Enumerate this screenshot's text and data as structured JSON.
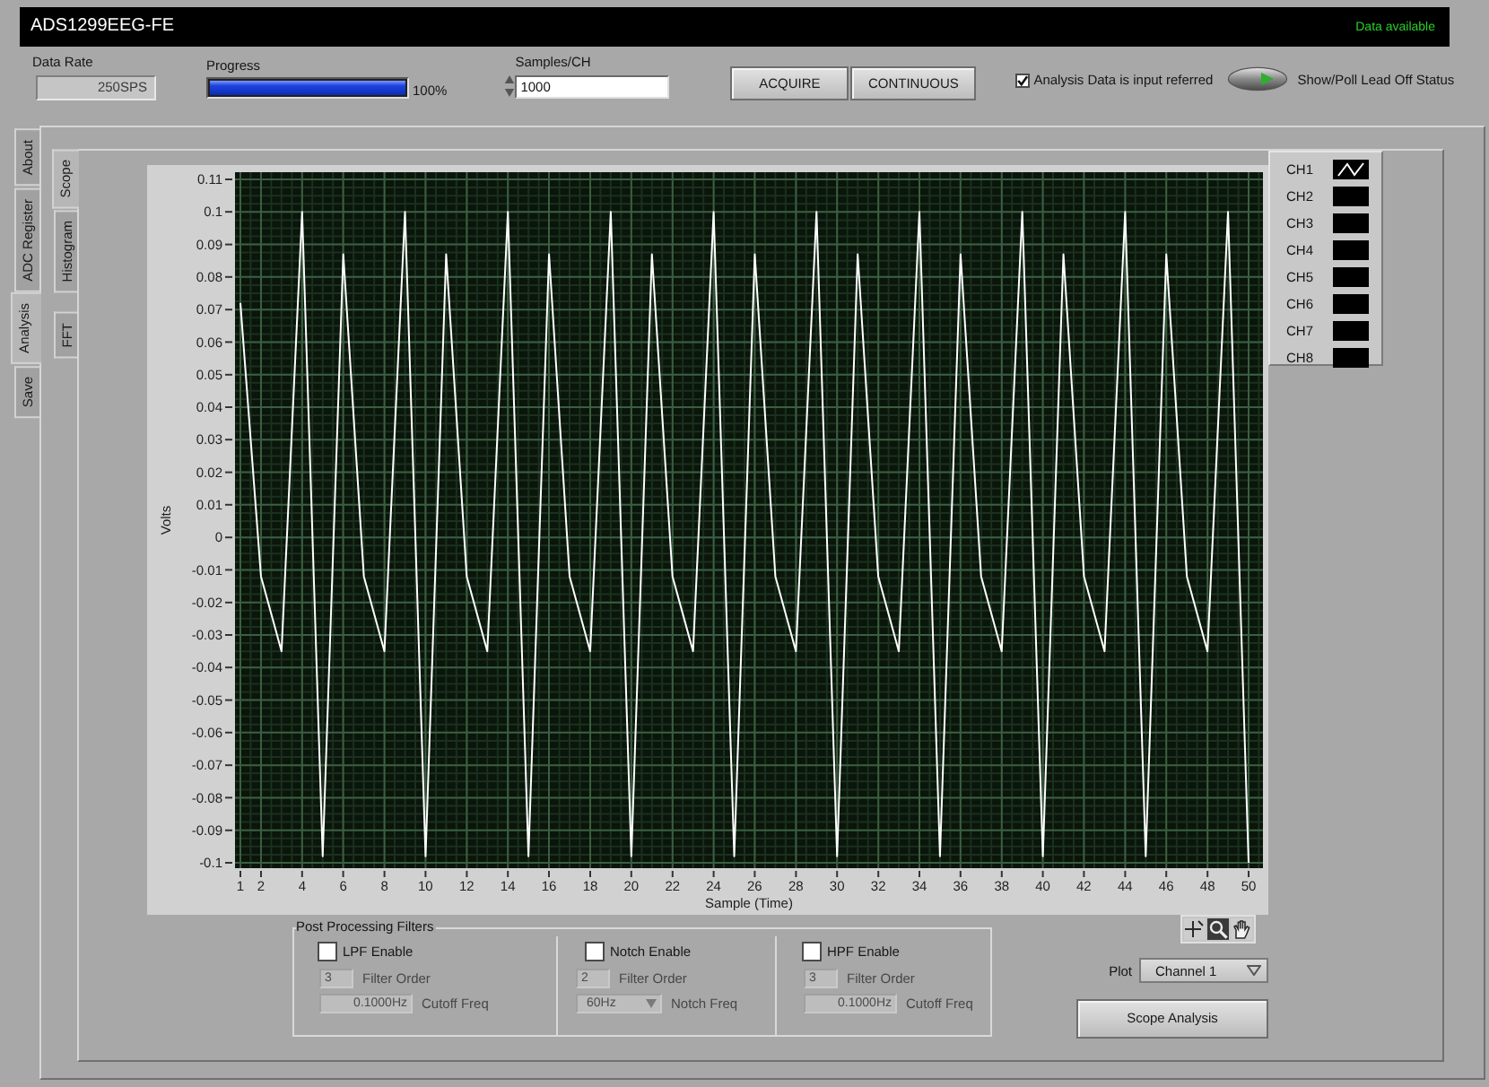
{
  "window": {
    "title": "ADS1299EEG-FE",
    "status": "Data available"
  },
  "controls": {
    "data_rate": {
      "label": "Data Rate",
      "value": "250SPS"
    },
    "progress": {
      "label": "Progress",
      "level": 1,
      "reading": "100%"
    },
    "samples": {
      "label": "Samples/CH",
      "value": "1000"
    },
    "buttons": [
      "ACQUIRE",
      "CONTINUOUS"
    ],
    "input_referred": {
      "label": "Analysis Data is input referred",
      "checked": true
    },
    "lead_off": {
      "label": "Show/Poll Lead Off Status",
      "on": false
    }
  },
  "main_tabs": [
    {
      "label": "About",
      "selected": false
    },
    {
      "label": "ADC Register",
      "selected": false
    },
    {
      "label": "Analysis",
      "selected": true
    },
    {
      "label": "Save",
      "selected": false
    }
  ],
  "view_tabs": [
    {
      "label": "Scope",
      "selected": true
    },
    {
      "label": "Histogram",
      "selected": false
    },
    {
      "label": "FFT",
      "selected": false
    }
  ],
  "graph": {
    "chart_data": {
      "type": "line",
      "grid": true,
      "xlabel": "Sample (Time)",
      "ylabel": "Volts",
      "x": [
        1,
        2,
        3,
        4,
        5,
        6,
        7,
        8,
        9,
        10,
        11,
        12,
        13,
        14,
        15,
        16,
        17,
        18,
        19,
        20,
        21,
        22,
        23,
        24,
        25,
        26,
        27,
        28,
        29,
        30,
        31,
        32,
        33,
        34,
        35,
        36,
        37,
        38,
        39,
        40,
        41,
        42,
        43,
        44,
        45,
        46,
        47,
        48,
        49,
        50
      ],
      "series": [
        {
          "color": "#ffffff",
          "values": [
            0.072,
            -0.012,
            -0.035,
            0.1,
            -0.098,
            0.087,
            -0.012,
            -0.035,
            0.1,
            -0.098,
            0.087,
            -0.012,
            -0.035,
            0.1,
            -0.098,
            0.087,
            -0.012,
            -0.035,
            0.1,
            -0.098,
            0.087,
            -0.012,
            -0.035,
            0.1,
            -0.098,
            0.087,
            -0.012,
            -0.035,
            0.1,
            -0.098,
            0.087,
            -0.012,
            -0.035,
            0.1,
            -0.098,
            0.087,
            -0.012,
            -0.035,
            0.1,
            -0.098,
            0.087,
            -0.012,
            -0.035,
            0.1,
            -0.098,
            0.087,
            -0.012,
            -0.035,
            0.1,
            -0.1
          ]
        }
      ],
      "xlim": [
        1,
        50
      ],
      "ylim": [
        -0.1,
        0.11
      ],
      "xticks": [
        1,
        2,
        4,
        6,
        8,
        10,
        12,
        14,
        16,
        18,
        20,
        22,
        24,
        26,
        28,
        30,
        32,
        34,
        36,
        38,
        40,
        42,
        44,
        46,
        48,
        50
      ],
      "yticks": [
        0.11,
        0.1,
        0.09,
        0.08,
        0.07,
        0.06,
        0.05,
        0.04,
        0.03,
        0.02,
        0.01,
        0,
        -0.01,
        -0.02,
        -0.03,
        -0.04,
        -0.05,
        -0.06,
        -0.07,
        -0.08,
        -0.09,
        -0.1
      ]
    },
    "legend": [
      {
        "label": "CH1",
        "shown": true
      },
      {
        "label": "CH2",
        "shown": false
      },
      {
        "label": "CH3",
        "shown": false
      },
      {
        "label": "CH4",
        "shown": false
      },
      {
        "label": "CH5",
        "shown": false
      },
      {
        "label": "CH6",
        "shown": false
      },
      {
        "label": "CH7",
        "shown": false
      },
      {
        "label": "CH8",
        "shown": false
      }
    ]
  },
  "graph_tools": [
    {
      "kind": "cursor",
      "selected": false
    },
    {
      "kind": "zoom",
      "selected": true
    },
    {
      "kind": "pan",
      "selected": false
    }
  ],
  "plot_select": {
    "label": "Plot",
    "value": "Channel 1"
  },
  "filters": {
    "title": "Post Processing Filters",
    "items": [
      {
        "label": "LPF Enable",
        "checked": false,
        "disabled": true,
        "order": {
          "value": "3",
          "label": "Filter Order"
        },
        "frequency": {
          "kind": "numeric",
          "value": "0.1000Hz",
          "label": "Cutoff Freq"
        }
      },
      {
        "label": "Notch Enable",
        "checked": false,
        "disabled": true,
        "order": {
          "value": "2",
          "label": "Filter Order"
        },
        "frequency": {
          "kind": "ring",
          "value": "60Hz",
          "label": "Notch Freq"
        }
      },
      {
        "label": "HPF Enable",
        "checked": false,
        "disabled": true,
        "order": {
          "value": "3",
          "label": "Filter Order"
        },
        "frequency": {
          "kind": "numeric",
          "value": "0.1000Hz",
          "label": "Cutoff Freq"
        }
      }
    ]
  },
  "analysis_button": "Scope Analysis"
}
